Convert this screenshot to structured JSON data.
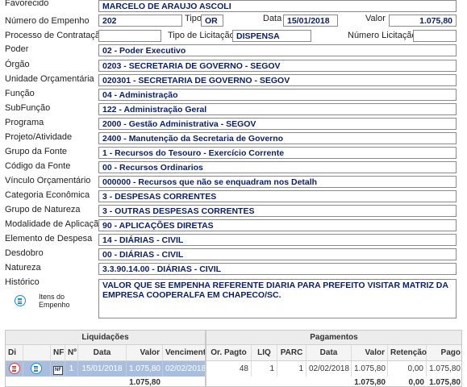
{
  "form": {
    "favorecido": {
      "label": "Favorecido",
      "value": "MARCELO DE ARAUJO ASCOLI"
    },
    "numero_empenho": {
      "label": "Número do Empenho",
      "value": "202"
    },
    "tipo": {
      "label": "Tipo",
      "value": "OR"
    },
    "data": {
      "label": "Data",
      "value": "15/01/2018"
    },
    "valor": {
      "label": "Valor",
      "value": "1.075,80"
    },
    "processo": {
      "label": "Processo de Contratação",
      "value": ""
    },
    "tipo_licitacao": {
      "label": "Tipo de Licitação",
      "value": "DISPENSA"
    },
    "numero_licitacao": {
      "label": "Número Licitação",
      "value": ""
    },
    "poder": {
      "label": "Poder",
      "value": "02 - Poder Executivo"
    },
    "orgao": {
      "label": "Órgão",
      "value": "0203 - SECRETARIA DE GOVERNO - SEGOV"
    },
    "unidade": {
      "label": "Unidade Orçamentária",
      "value": "020301 - SECRETARIA DE GOVERNO - SEGOV"
    },
    "funcao": {
      "label": "Função",
      "value": "04 - Administração"
    },
    "subfuncao": {
      "label": "SubFunção",
      "value": "122 - Administração Geral"
    },
    "programa": {
      "label": "Programa",
      "value": "2000 - Gestão Administrativa - SEGOV"
    },
    "projeto": {
      "label": "Projeto/Atividade",
      "value": "2400 - Manutenção da Secretaria de Governo"
    },
    "grupo_fonte": {
      "label": "Grupo da Fonte",
      "value": "1 - Recursos do Tesouro - Exercício Corrente"
    },
    "codigo_fonte": {
      "label": "Código da Fonte",
      "value": "00 - Recursos Ordinarios"
    },
    "vinculo": {
      "label": "Vínculo Orçamentário",
      "value": "000000 - Recursos que não se enquadram nos Detalh"
    },
    "categoria": {
      "label": "Categoria Econômica",
      "value": "3 - DESPESAS CORRENTES"
    },
    "grupo_natureza": {
      "label": "Grupo de Natureza",
      "value": "3 - OUTRAS DESPESAS CORRENTES"
    },
    "modalidade": {
      "label": "Modalidade de Aplicação",
      "value": "90 - APLICAÇÕES DIRETAS"
    },
    "elemento": {
      "label": "Elemento de Despesa",
      "value": "14 - DIÁRIAS - CIVIL"
    },
    "desdobro": {
      "label": "Desdobro",
      "value": "00 - DIÁRIAS - CIVIL"
    },
    "natureza": {
      "label": "Natureza",
      "value": "3.3.90.14.00 - DIÁRIAS - CIVIL"
    },
    "historico": {
      "label": "Histórico",
      "value": "VALOR QUE SE EMPENHA REFERENTE DIARIA PARA PREFEITO VISITAR MATRIZ DA EMPRESA COOPERALFA EM CHAPECO/SC."
    }
  },
  "itens_button": {
    "line1": "Itens do",
    "line2": "Empenho",
    "icon": "list-icon"
  },
  "liquidacoes": {
    "title": "Liquidações",
    "headers": {
      "di": "Di",
      "nf": "NF",
      "n": "Nº",
      "data": "Data",
      "valor": "Valor",
      "vencimento": "Vencimento"
    },
    "row": {
      "nf": "NF",
      "n": "1",
      "data": "15/01/2018",
      "valor": "1.075,80",
      "vencimento": "02/02/2018"
    },
    "total": "1.075,80"
  },
  "pagamentos": {
    "title": "Pagamentos",
    "headers": {
      "or_pagto": "Or. Pagto",
      "liq": "LIQ",
      "parc": "PARC",
      "data": "Data",
      "valor": "Valor",
      "retencao": "Retenção",
      "pago": "Pago"
    },
    "row": {
      "or_pagto": "48",
      "liq": "1",
      "parc": "1",
      "data": "02/02/2018",
      "valor": "1.075,80",
      "retencao": "0,00",
      "pago": "1.075,80"
    },
    "totals": {
      "valor": "1.075,80",
      "retencao": "0,00",
      "pago": "1.075,80"
    }
  },
  "colors": {
    "value_text": "#0b1f66",
    "selected_row": "#a9bedc",
    "di_icon": "#e53935",
    "list_icon": "#1e88e5"
  }
}
